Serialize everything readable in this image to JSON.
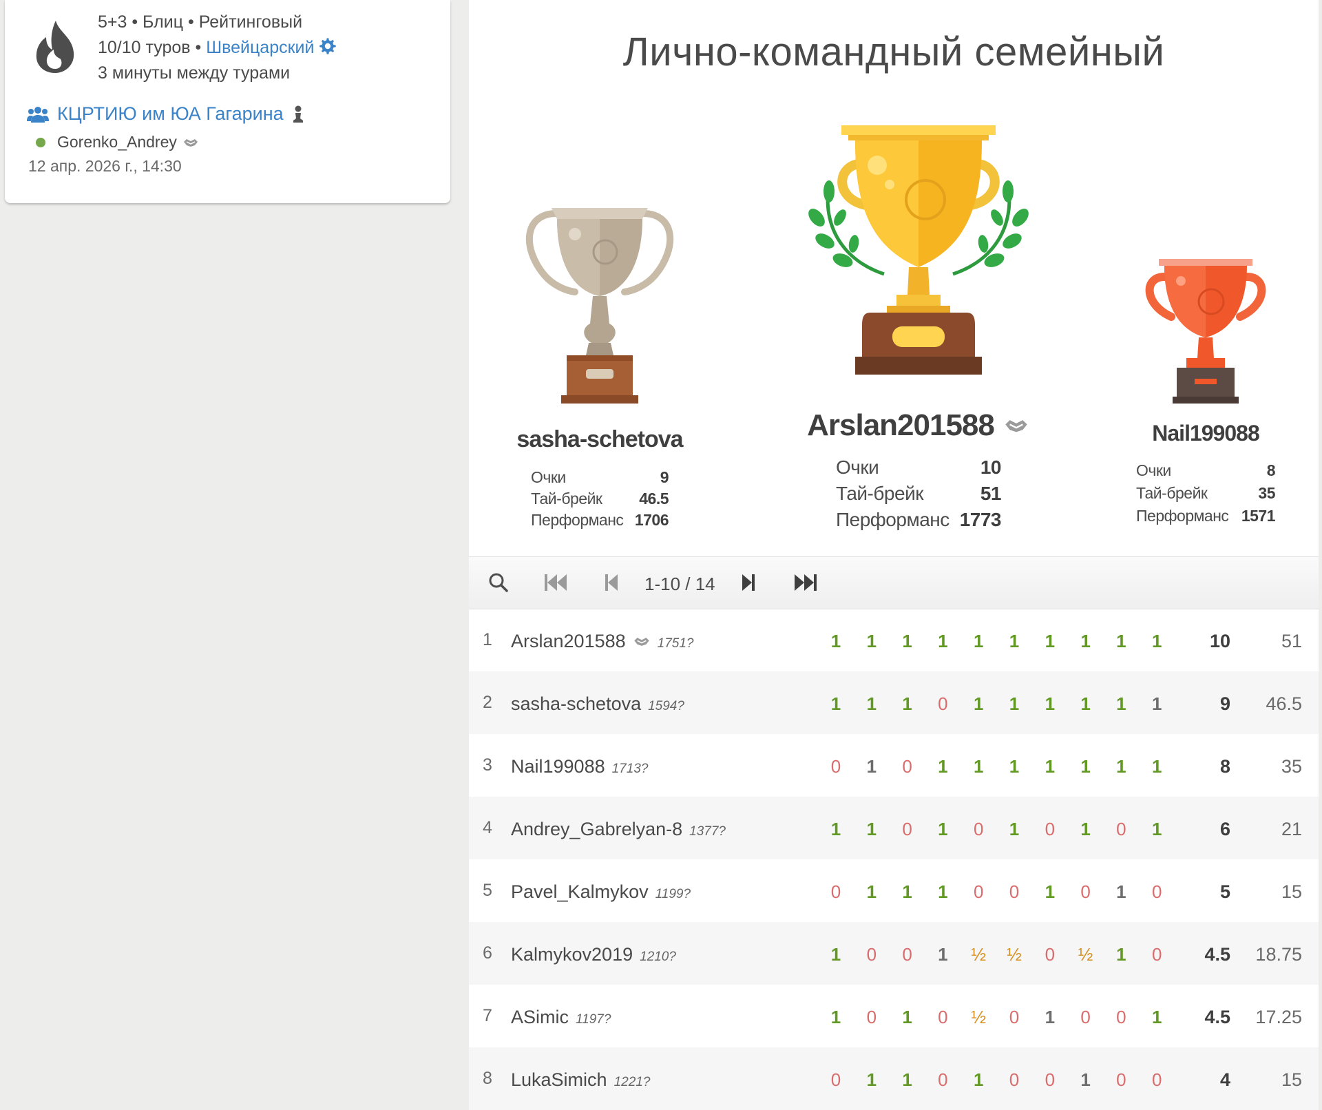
{
  "info": {
    "setup_line": "5+3 • Блиц • Рейтинговый",
    "rounds_prefix": "10/10 туров • ",
    "system_link": "Швейцарский",
    "pause_line": "3 минуты между турами",
    "team_name": "КЦРТИЮ им ЮА Гагарина",
    "creator": "Gorenko_Andrey",
    "date": "12 апр. 2026 г., 14:30"
  },
  "title": "Лично-командный семейный",
  "podium": {
    "labels": {
      "points": "Очки",
      "tiebreak": "Тай-брейк",
      "performance": "Перформанс"
    },
    "first": {
      "name": "Arslan201588",
      "points": "10",
      "tiebreak": "51",
      "performance": "1773"
    },
    "second": {
      "name": "sasha-schetova",
      "points": "9",
      "tiebreak": "46.5",
      "performance": "1706"
    },
    "third": {
      "name": "Nail199088",
      "points": "8",
      "tiebreak": "35",
      "performance": "1571"
    }
  },
  "pager": {
    "info": "1-10 / 14"
  },
  "standings": [
    {
      "rank": "1",
      "name": "Arslan201588",
      "rating": "1751?",
      "badge": true,
      "results": [
        "1",
        "1",
        "1",
        "1",
        "1",
        "1",
        "1",
        "1",
        "1",
        "1"
      ],
      "points": "10",
      "tiebreak": "51"
    },
    {
      "rank": "2",
      "name": "sasha-schetova",
      "rating": "1594?",
      "badge": false,
      "results": [
        "1",
        "1",
        "1",
        "0",
        "1",
        "1",
        "1",
        "1",
        "1",
        "1"
      ],
      "points": "9",
      "tiebreak": "46.5"
    },
    {
      "rank": "3",
      "name": "Nail199088",
      "rating": "1713?",
      "badge": false,
      "results": [
        "0",
        "1",
        "0",
        "1",
        "1",
        "1",
        "1",
        "1",
        "1",
        "1"
      ],
      "points": "8",
      "tiebreak": "35"
    },
    {
      "rank": "4",
      "name": "Andrey_Gabrelyan-8",
      "rating": "1377?",
      "badge": false,
      "results": [
        "1",
        "1",
        "0",
        "1",
        "0",
        "1",
        "0",
        "1",
        "0",
        "1"
      ],
      "points": "6",
      "tiebreak": "21"
    },
    {
      "rank": "5",
      "name": "Pavel_Kalmykov",
      "rating": "1199?",
      "badge": false,
      "results": [
        "0",
        "1",
        "1",
        "1",
        "0",
        "0",
        "1",
        "0",
        "1",
        "0"
      ],
      "points": "5",
      "tiebreak": "15"
    },
    {
      "rank": "6",
      "name": "Kalmykov2019",
      "rating": "1210?",
      "badge": false,
      "results": [
        "1",
        "0",
        "0",
        "1",
        "½",
        "½",
        "0",
        "½",
        "1",
        "0"
      ],
      "points": "4.5",
      "tiebreak": "18.75"
    },
    {
      "rank": "7",
      "name": "ASimic",
      "rating": "1197?",
      "badge": false,
      "results": [
        "1",
        "0",
        "1",
        "0",
        "½",
        "0",
        "1",
        "0",
        "0",
        "1"
      ],
      "points": "4.5",
      "tiebreak": "17.25"
    },
    {
      "rank": "8",
      "name": "LukaSimich",
      "rating": "1221?",
      "badge": false,
      "results": [
        "0",
        "1",
        "1",
        "0",
        "1",
        "0",
        "0",
        "1",
        "0",
        "0"
      ],
      "points": "4",
      "tiebreak": "15"
    }
  ],
  "colors": {
    "win": "#629924",
    "loss": "#d96d6d",
    "draw": "#d59020",
    "link": "#3b83c8"
  }
}
